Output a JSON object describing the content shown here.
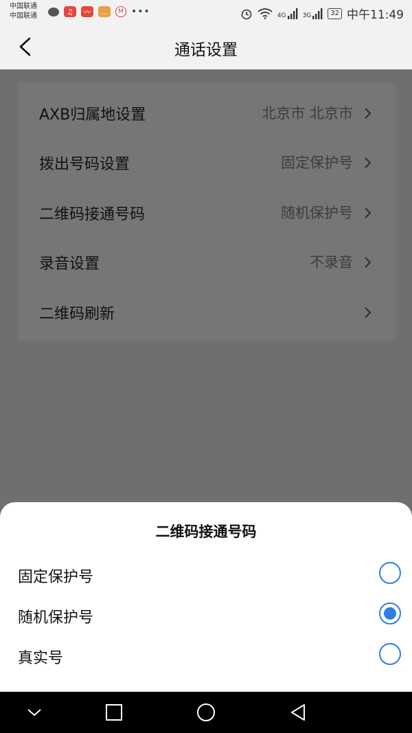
{
  "status_bar": {
    "carrier_1": "中国联通",
    "carrier_2": "中国联通",
    "network_1": "4G",
    "network_2": "3G",
    "battery": "32",
    "time": "中午11:49",
    "icons": [
      "message-icon",
      "app-icon",
      "stock-icon",
      "chat-icon",
      "bank-icon",
      "more-icon",
      "alarm-icon",
      "wifi-icon",
      "signal-icon",
      "battery-icon"
    ]
  },
  "nav": {
    "title": "通话设置",
    "back_icon": "back-arrow-icon"
  },
  "settings": {
    "items": [
      {
        "label": "AXB归属地设置",
        "value": "北京市 北京市"
      },
      {
        "label": "拨出号码设置",
        "value": "固定保护号"
      },
      {
        "label": "二维码接通号码",
        "value": "随机保护号"
      },
      {
        "label": "录音设置",
        "value": "不录音"
      },
      {
        "label": "二维码刷新",
        "value": ""
      }
    ]
  },
  "sheet": {
    "title": "二维码接通号码",
    "options": [
      {
        "label": "固定保护号",
        "selected": false
      },
      {
        "label": "随机保护号",
        "selected": true
      },
      {
        "label": "真实号",
        "selected": false
      }
    ]
  },
  "colors": {
    "accent": "#2f7de1",
    "overlay": "#6f6f6f",
    "sheet_bg": "#ffffff"
  }
}
